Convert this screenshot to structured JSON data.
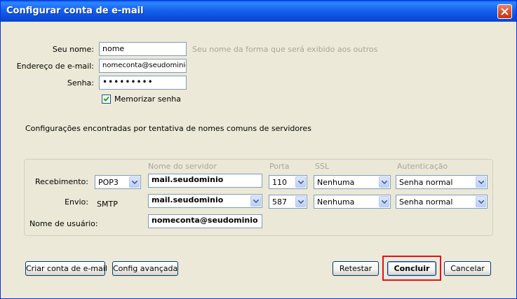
{
  "window": {
    "title": "Configurar conta de e-mail",
    "close_icon": "close-icon"
  },
  "form": {
    "name_label": "Seu nome:",
    "name_value": "nome",
    "name_hint": "Seu nome da forma que será exibido aos outros",
    "email_label": "Endereço de e-mail:",
    "email_value": "nomeconta@seudominio",
    "password_label": "Senha:",
    "password_value": "•••••••••",
    "remember_label": "Memorizar senha",
    "remember_checked": true
  },
  "status_text": "Configurações encontradas por tentativa de nomes comuns de servidores",
  "server": {
    "headers": {
      "server_name": "Nome do servidor",
      "port": "Porta",
      "ssl": "SSL",
      "auth": "Autenticação"
    },
    "incoming": {
      "label": "Recebimento:",
      "protocol": "POP3",
      "server": "mail.seudominio",
      "port": "110",
      "ssl": "Nenhuma",
      "auth": "Senha normal"
    },
    "outgoing": {
      "label": "Envio:",
      "protocol": "SMTP",
      "server": "mail.seudominio",
      "port": "587",
      "ssl": "Nenhuma",
      "auth": "Senha normal"
    },
    "username_label": "Nome de usuário:",
    "username_value": "nomeconta@seudominio"
  },
  "buttons": {
    "create_account": "Criar conta de e-mail",
    "advanced": "Config avançada",
    "retest": "Retestar",
    "done": "Concluir",
    "cancel": "Cancelar"
  },
  "colors": {
    "highlight": "#e0101e",
    "title_bar": "#0a5ef0"
  }
}
